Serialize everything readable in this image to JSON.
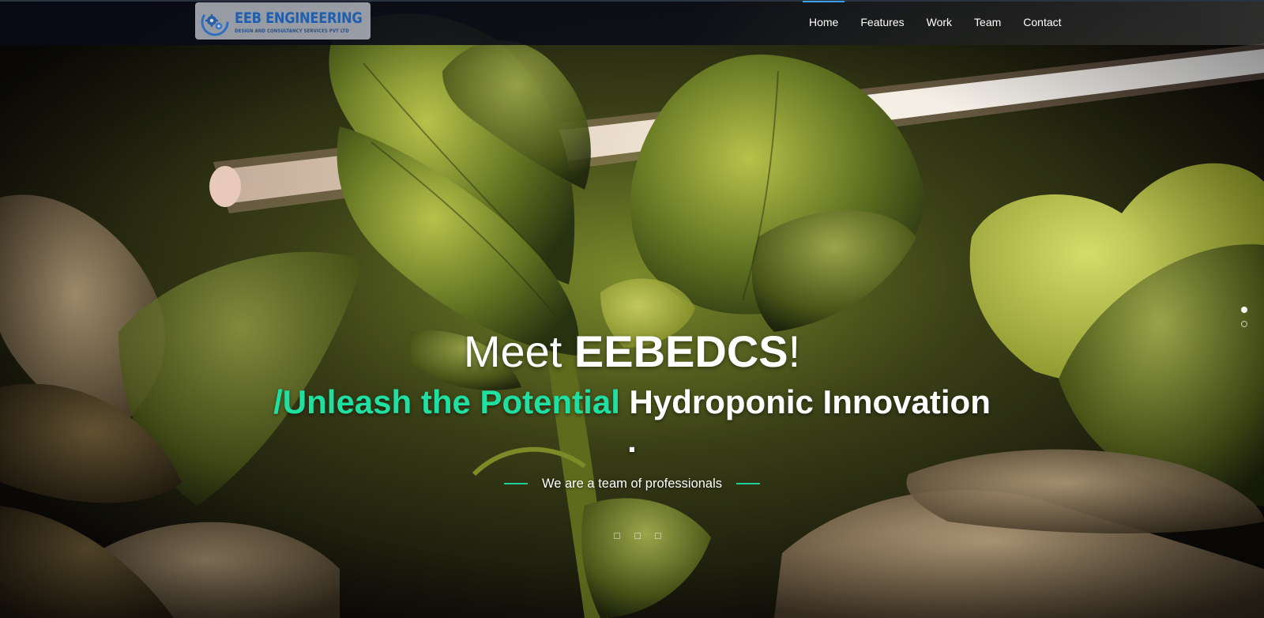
{
  "logo": {
    "name": "EEB ENGINEERING",
    "tagline": "DESIGN AND CONSULTANCY SERVICES PVT LTD",
    "icon": "gear-cluster-icon"
  },
  "nav": {
    "items": [
      {
        "label": "Home",
        "active": true
      },
      {
        "label": "Features",
        "active": false
      },
      {
        "label": "Work",
        "active": false
      },
      {
        "label": "Team",
        "active": false
      },
      {
        "label": "Contact",
        "active": false
      }
    ],
    "active_color": "#3aa0e8"
  },
  "hero": {
    "title_prefix": "Meet ",
    "title_brand": "EEBEDCS",
    "title_suffix": "!",
    "subtitle_accent": "/Unleash the Potential",
    "subtitle_rest": " Hydroponic Innovation .",
    "tagline": "We are a team of professionals",
    "accent_color": "#1fe0a0",
    "background": "hydroponic-plant-under-grow-light"
  },
  "slider": {
    "vertical_dots": 2,
    "active_dot": 0,
    "indicators": 3
  }
}
